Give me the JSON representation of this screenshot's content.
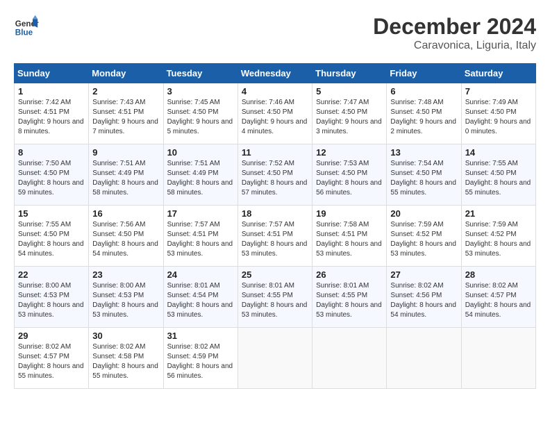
{
  "header": {
    "logo_line1": "General",
    "logo_line2": "Blue",
    "month": "December 2024",
    "location": "Caravonica, Liguria, Italy"
  },
  "weekdays": [
    "Sunday",
    "Monday",
    "Tuesday",
    "Wednesday",
    "Thursday",
    "Friday",
    "Saturday"
  ],
  "weeks": [
    [
      {
        "day": "1",
        "sunrise": "7:42 AM",
        "sunset": "4:51 PM",
        "daylight": "9 hours and 8 minutes."
      },
      {
        "day": "2",
        "sunrise": "7:43 AM",
        "sunset": "4:51 PM",
        "daylight": "9 hours and 7 minutes."
      },
      {
        "day": "3",
        "sunrise": "7:45 AM",
        "sunset": "4:50 PM",
        "daylight": "9 hours and 5 minutes."
      },
      {
        "day": "4",
        "sunrise": "7:46 AM",
        "sunset": "4:50 PM",
        "daylight": "9 hours and 4 minutes."
      },
      {
        "day": "5",
        "sunrise": "7:47 AM",
        "sunset": "4:50 PM",
        "daylight": "9 hours and 3 minutes."
      },
      {
        "day": "6",
        "sunrise": "7:48 AM",
        "sunset": "4:50 PM",
        "daylight": "9 hours and 2 minutes."
      },
      {
        "day": "7",
        "sunrise": "7:49 AM",
        "sunset": "4:50 PM",
        "daylight": "9 hours and 0 minutes."
      }
    ],
    [
      {
        "day": "8",
        "sunrise": "7:50 AM",
        "sunset": "4:50 PM",
        "daylight": "8 hours and 59 minutes."
      },
      {
        "day": "9",
        "sunrise": "7:51 AM",
        "sunset": "4:49 PM",
        "daylight": "8 hours and 58 minutes."
      },
      {
        "day": "10",
        "sunrise": "7:51 AM",
        "sunset": "4:49 PM",
        "daylight": "8 hours and 58 minutes."
      },
      {
        "day": "11",
        "sunrise": "7:52 AM",
        "sunset": "4:50 PM",
        "daylight": "8 hours and 57 minutes."
      },
      {
        "day": "12",
        "sunrise": "7:53 AM",
        "sunset": "4:50 PM",
        "daylight": "8 hours and 56 minutes."
      },
      {
        "day": "13",
        "sunrise": "7:54 AM",
        "sunset": "4:50 PM",
        "daylight": "8 hours and 55 minutes."
      },
      {
        "day": "14",
        "sunrise": "7:55 AM",
        "sunset": "4:50 PM",
        "daylight": "8 hours and 55 minutes."
      }
    ],
    [
      {
        "day": "15",
        "sunrise": "7:55 AM",
        "sunset": "4:50 PM",
        "daylight": "8 hours and 54 minutes."
      },
      {
        "day": "16",
        "sunrise": "7:56 AM",
        "sunset": "4:50 PM",
        "daylight": "8 hours and 54 minutes."
      },
      {
        "day": "17",
        "sunrise": "7:57 AM",
        "sunset": "4:51 PM",
        "daylight": "8 hours and 53 minutes."
      },
      {
        "day": "18",
        "sunrise": "7:57 AM",
        "sunset": "4:51 PM",
        "daylight": "8 hours and 53 minutes."
      },
      {
        "day": "19",
        "sunrise": "7:58 AM",
        "sunset": "4:51 PM",
        "daylight": "8 hours and 53 minutes."
      },
      {
        "day": "20",
        "sunrise": "7:59 AM",
        "sunset": "4:52 PM",
        "daylight": "8 hours and 53 minutes."
      },
      {
        "day": "21",
        "sunrise": "7:59 AM",
        "sunset": "4:52 PM",
        "daylight": "8 hours and 53 minutes."
      }
    ],
    [
      {
        "day": "22",
        "sunrise": "8:00 AM",
        "sunset": "4:53 PM",
        "daylight": "8 hours and 53 minutes."
      },
      {
        "day": "23",
        "sunrise": "8:00 AM",
        "sunset": "4:53 PM",
        "daylight": "8 hours and 53 minutes."
      },
      {
        "day": "24",
        "sunrise": "8:01 AM",
        "sunset": "4:54 PM",
        "daylight": "8 hours and 53 minutes."
      },
      {
        "day": "25",
        "sunrise": "8:01 AM",
        "sunset": "4:55 PM",
        "daylight": "8 hours and 53 minutes."
      },
      {
        "day": "26",
        "sunrise": "8:01 AM",
        "sunset": "4:55 PM",
        "daylight": "8 hours and 53 minutes."
      },
      {
        "day": "27",
        "sunrise": "8:02 AM",
        "sunset": "4:56 PM",
        "daylight": "8 hours and 54 minutes."
      },
      {
        "day": "28",
        "sunrise": "8:02 AM",
        "sunset": "4:57 PM",
        "daylight": "8 hours and 54 minutes."
      }
    ],
    [
      {
        "day": "29",
        "sunrise": "8:02 AM",
        "sunset": "4:57 PM",
        "daylight": "8 hours and 55 minutes."
      },
      {
        "day": "30",
        "sunrise": "8:02 AM",
        "sunset": "4:58 PM",
        "daylight": "8 hours and 55 minutes."
      },
      {
        "day": "31",
        "sunrise": "8:02 AM",
        "sunset": "4:59 PM",
        "daylight": "8 hours and 56 minutes."
      },
      null,
      null,
      null,
      null
    ]
  ]
}
